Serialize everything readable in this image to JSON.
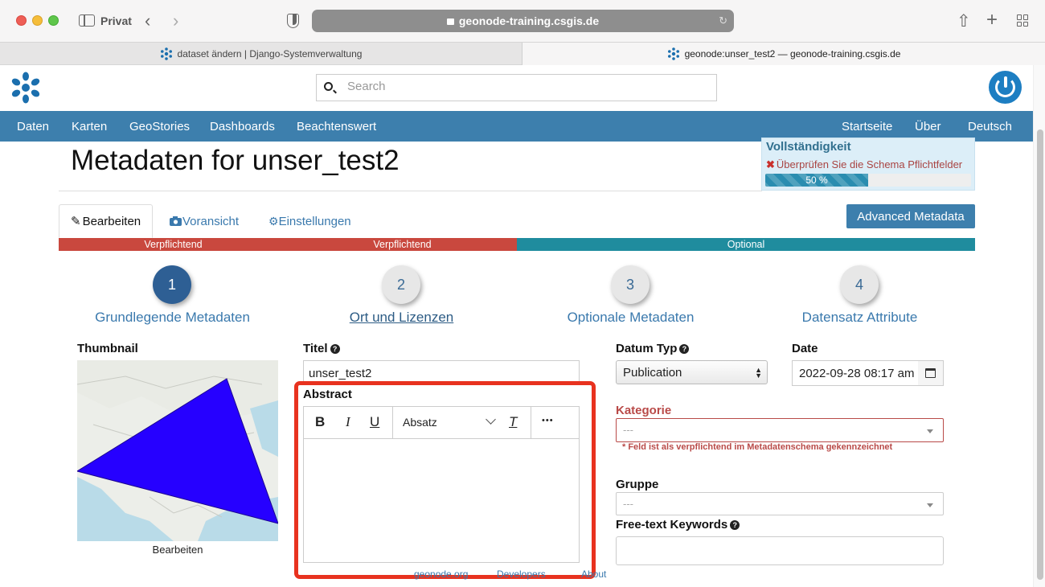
{
  "browser": {
    "privacy_label": "Privat",
    "url": "geonode-training.csgis.de",
    "tabs": [
      {
        "label": "dataset ändern | Django-Systemverwaltung"
      },
      {
        "label": "geonode:unser_test2 — geonode-training.csgis.de"
      }
    ]
  },
  "header": {
    "search_placeholder": "Search"
  },
  "nav": {
    "left": [
      "Daten",
      "Karten",
      "GeoStories",
      "Dashboards",
      "Beachtenswert"
    ],
    "right": [
      "Startseite",
      "Über",
      "Deutsch"
    ]
  },
  "page": {
    "title": "Metadaten for unser_test2"
  },
  "completeness": {
    "title": "Vollständigkeit",
    "warning": "Überprüfen Sie die Schema Pflichtfelder",
    "progress_label": "50 %",
    "progress_value": 0.5
  },
  "tabs": {
    "edit": "Bearbeiten",
    "preview": "Voransicht",
    "settings": "Einstellungen",
    "advanced_button": "Advanced Metadata"
  },
  "requirements": [
    "Verpflichtend",
    "Verpflichtend",
    "Optional"
  ],
  "steps": [
    {
      "number": "1",
      "label": "Grundlegende Metadaten"
    },
    {
      "number": "2",
      "label": "Ort und Lizenzen"
    },
    {
      "number": "3",
      "label": "Optionale Metadaten"
    },
    {
      "number": "4",
      "label": "Datensatz Attribute"
    }
  ],
  "form": {
    "thumbnail_label": "Thumbnail",
    "thumbnail_caption": "Bearbeiten",
    "title_label": "Titel",
    "title_value": "unser_test2",
    "abstract_label": "Abstract",
    "editor": {
      "bold": "B",
      "italic": "I",
      "underline": "U",
      "block_format": "Absatz",
      "clear_format": "T",
      "more": "•••"
    },
    "date_type_label": "Datum Typ",
    "date_type_value": "Publication",
    "date_label": "Date",
    "date_value": "2022-09-28 08:17 am",
    "category_label": "Kategorie",
    "category_placeholder": "---",
    "category_error": "* Feld ist als verpflichtend im Metadatenschema gekennzeichnet",
    "group_label": "Gruppe",
    "group_placeholder": "---",
    "keywords_label": "Free-text Keywords"
  },
  "footer": [
    "geonode.org",
    "Developers",
    "About"
  ],
  "colors": {
    "navbar": "#3d7fad",
    "required": "#c9483e",
    "optional": "#1f8c9e",
    "highlight": "#e8321f",
    "thumbnail_polygon": "#2600ff"
  }
}
